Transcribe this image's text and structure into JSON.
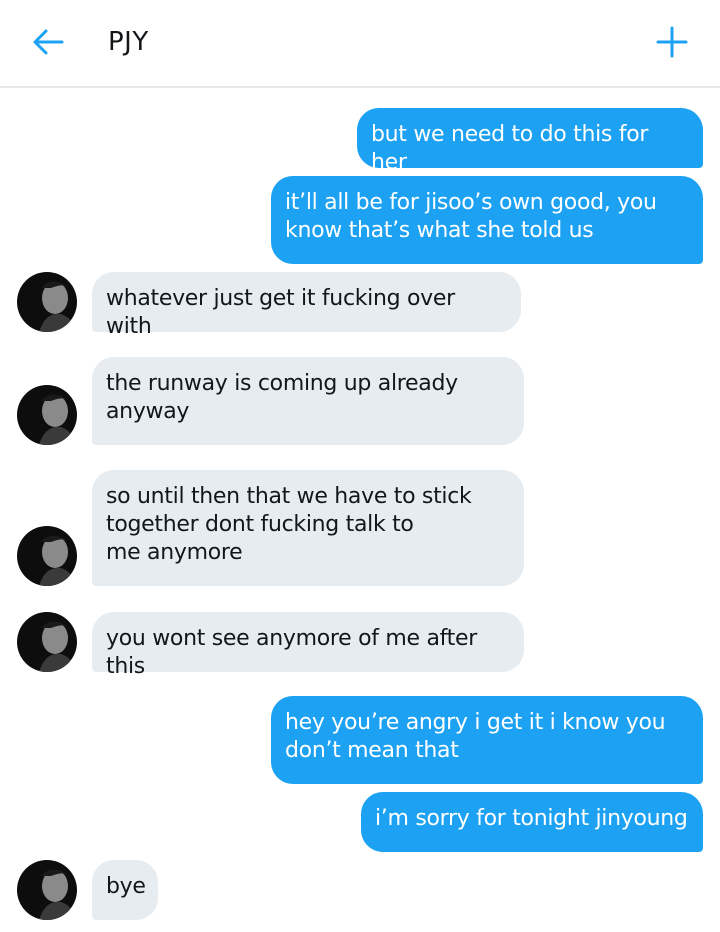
{
  "header": {
    "title": "PJY",
    "back_icon": "arrow-left-icon",
    "add_icon": "plus-icon",
    "accent": "#1da1f2"
  },
  "messages": [
    {
      "side": "out",
      "text": "but we need to do this for her"
    },
    {
      "side": "out",
      "text": "it’ll all be for jisoo’s own good, you\nknow that’s what she told us"
    },
    {
      "side": "in",
      "text": "whatever just get it fucking over with"
    },
    {
      "side": "in",
      "text": "the runway is coming up already\nanyway"
    },
    {
      "side": "in",
      "text": "so until then that we have to stick\ntogether dont fucking talk to\nme anymore"
    },
    {
      "side": "in",
      "text": "you wont see anymore of me after this"
    },
    {
      "side": "out",
      "text": "hey you’re angry i get it i know you\ndon’t mean that"
    },
    {
      "side": "out",
      "text": "i’m sorry for tonight jinyoung"
    },
    {
      "side": "in",
      "text": "bye"
    }
  ],
  "colors": {
    "outgoing_bubble": "#1da1f2",
    "incoming_bubble": "#e6ecf0",
    "avatar": "#111111"
  }
}
